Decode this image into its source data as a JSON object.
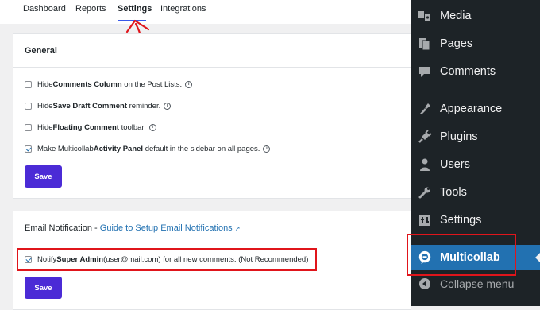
{
  "tabs": [
    {
      "label": "Dashboard"
    },
    {
      "label": "Reports"
    },
    {
      "label": "Settings"
    },
    {
      "label": "Integrations"
    }
  ],
  "general": {
    "title": "General",
    "options": [
      {
        "pre": "Hide ",
        "bold": "Comments Column",
        "post": " on the Post Lists.",
        "checked": false
      },
      {
        "pre": "Hide ",
        "bold": "Save Draft Comment",
        "post": " reminder.",
        "checked": false
      },
      {
        "pre": "Hide ",
        "bold": "Floating Comment",
        "post": " toolbar.",
        "checked": false
      },
      {
        "pre": "Make Multicollab ",
        "bold": "Activity Panel",
        "post": " default in the sidebar on all pages.",
        "checked": true
      }
    ],
    "save_label": "Save"
  },
  "email": {
    "title": "Email Notification",
    "separator": " - ",
    "guide_link": "Guide to Setup Email Notifications",
    "option": {
      "pre": "Notify ",
      "bold": "Super Admin",
      "post": " (user@mail.com) for all new comments. (Not Recommended)",
      "checked": true
    },
    "save_label": "Save"
  },
  "sidebar": {
    "items": [
      {
        "label": "Media",
        "icon": "media-icon"
      },
      {
        "label": "Pages",
        "icon": "pages-icon"
      },
      {
        "label": "Comments",
        "icon": "comments-icon"
      },
      {
        "label": "Appearance",
        "icon": "appearance-icon"
      },
      {
        "label": "Plugins",
        "icon": "plugins-icon"
      },
      {
        "label": "Users",
        "icon": "users-icon"
      },
      {
        "label": "Tools",
        "icon": "tools-icon"
      },
      {
        "label": "Settings",
        "icon": "settings-icon"
      },
      {
        "label": "Multicollab",
        "icon": "multicollab-icon",
        "active": true
      },
      {
        "label": "Collapse menu",
        "icon": "collapse-icon"
      }
    ]
  },
  "colors": {
    "accent": "#4b2bd6",
    "link": "#2271b1",
    "sidebar_bg": "#1d2327",
    "highlight": "#e0151b"
  }
}
